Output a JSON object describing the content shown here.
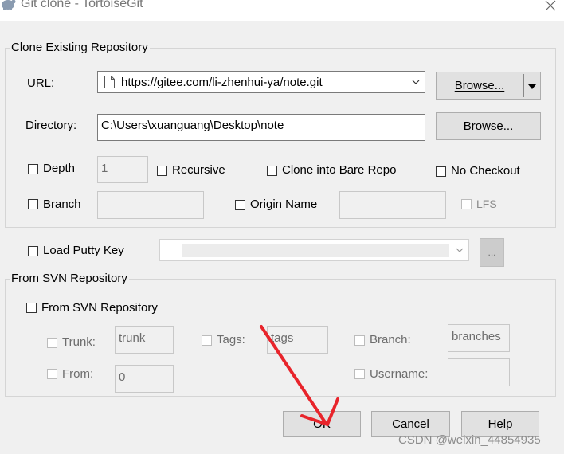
{
  "window": {
    "title": "Git clone - TortoiseGit",
    "close_icon": "close-icon"
  },
  "clone_group": {
    "title": "Clone Existing Repository",
    "url_label": "URL:",
    "url_value": "https://gitee.com/li-zhenhui-ya/note.git",
    "browse_label": "Browse...",
    "directory_label": "Directory:",
    "directory_value": "C:\\Users\\xuanguang\\Desktop\\note",
    "browse_dir_label": "Browse...",
    "depth_label": "Depth",
    "depth_value": "1",
    "recursive_label": "Recursive",
    "bare_label": "Clone into Bare Repo",
    "no_checkout_label": "No Checkout",
    "branch_label": "Branch",
    "branch_value": "",
    "origin_label": "Origin Name",
    "origin_value": "",
    "lfs_label": "LFS"
  },
  "putty": {
    "label": "Load Putty Key",
    "value": "",
    "browse_label": "..."
  },
  "svn_group": {
    "title": "From SVN Repository",
    "enable_label": "From SVN Repository",
    "trunk_label": "Trunk:",
    "trunk_value": "trunk",
    "tags_label": "Tags:",
    "tags_value": "tags",
    "branch_label": "Branch:",
    "branch_value": "branches",
    "from_label": "From:",
    "from_value": "0",
    "username_label": "Username:",
    "username_value": ""
  },
  "buttons": {
    "ok": "OK",
    "cancel": "Cancel",
    "help": "Help"
  },
  "watermark": "CSDN @weixin_44854935",
  "colors": {
    "annotation_arrow": "#e8242b",
    "dialog_bg": "#f0f0f0"
  }
}
